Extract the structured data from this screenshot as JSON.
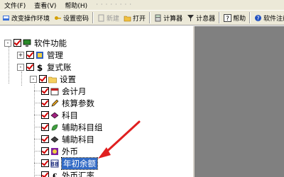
{
  "menu": [
    "文件(F)",
    "查看(V)",
    "帮助(H)",
    "·  ·  ·  ·  ·  ·  ·  ·"
  ],
  "toolbar": [
    {
      "label": "改变操作环境",
      "icon": "change-env-icon",
      "disabled": false
    },
    {
      "label": "设置密码",
      "icon": "key-icon",
      "disabled": false
    },
    {
      "label": "新建",
      "icon": "new-icon",
      "disabled": true
    },
    {
      "label": "打开",
      "icon": "open-folder-icon",
      "disabled": false
    },
    {
      "label": "计算器",
      "icon": "calculator-icon",
      "disabled": false
    },
    {
      "label": "计息器",
      "icon": "interest-calc-icon",
      "disabled": false
    },
    {
      "label": "帮助",
      "icon": "help-icon",
      "disabled": false
    },
    {
      "label": "软件注册",
      "icon": "register-icon",
      "disabled": false
    }
  ],
  "tree": {
    "root": "软件功能",
    "items": [
      {
        "label": "管理",
        "expander": "+"
      },
      {
        "label": "复式账",
        "expander": "-"
      },
      {
        "label": "设置",
        "expander": "-"
      },
      {
        "label": "会计月"
      },
      {
        "label": "核算参数"
      },
      {
        "label": "科目"
      },
      {
        "label": "辅助科目组"
      },
      {
        "label": "辅助科目"
      },
      {
        "label": "外币"
      },
      {
        "label": "年初余额",
        "selected": true
      },
      {
        "label": "外币汇率"
      }
    ]
  },
  "colors": {
    "annotation_arrow": "#e02020",
    "selection": "#316ac5",
    "check": "#d00000"
  }
}
